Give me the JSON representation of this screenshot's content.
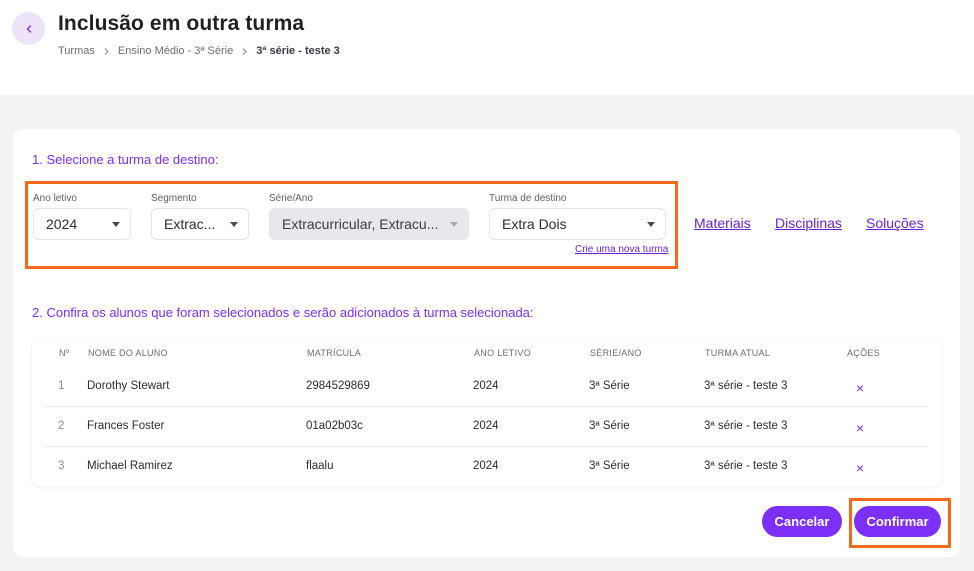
{
  "header": {
    "title": "Inclusão em outra turma",
    "breadcrumb": [
      "Turmas",
      "Ensino Médio - 3ª Série",
      "3ª série - teste 3"
    ]
  },
  "section1": {
    "title": "1. Selecione a turma de destino:",
    "fields": {
      "ano_letivo": {
        "label": "Ano letivo",
        "value": "2024"
      },
      "segmento": {
        "label": "Segmento",
        "value": "Extrac..."
      },
      "serie_ano": {
        "label": "Série/Ano",
        "value": "Extracurricular, Extracu..."
      },
      "turma_destino": {
        "label": "Turma de destino",
        "value": "Extra Dois"
      }
    },
    "new_class_link": "Crie uma nova turma",
    "links": [
      "Materiais",
      "Disciplinas",
      "Soluções"
    ]
  },
  "section2": {
    "title": "2. Confira os alunos que foram selecionados e serão adicionados à turma selecionada:",
    "columns": [
      "Nº",
      "NOME DO ALUNO",
      "MATRÍCULA",
      "ANO LETIVO",
      "SÉRIE/ANO",
      "TURMA ATUAL",
      "AÇÕES"
    ],
    "rows": [
      {
        "n": "1",
        "name": "Dorothy Stewart",
        "matricula": "2984529869",
        "ano": "2024",
        "serie": "3ª Série",
        "turma": "3ª série - teste 3",
        "action": "×"
      },
      {
        "n": "2",
        "name": "Frances Foster",
        "matricula": "01a02b03c",
        "ano": "2024",
        "serie": "3ª Série",
        "turma": "3ª série - teste 3",
        "action": "×"
      },
      {
        "n": "3",
        "name": "Michael Ramirez",
        "matricula": "flaalu",
        "ano": "2024",
        "serie": "3ª Série",
        "turma": "3ª série - teste 3",
        "action": "×"
      }
    ]
  },
  "actions": {
    "cancel": "Cancelar",
    "confirm": "Confirmar"
  },
  "icons": {
    "back": "chevron-left-icon",
    "breadcrumb_separator": "chevron-right-icon",
    "select": "caret-down-icon",
    "remove": "close-icon"
  },
  "colors": {
    "accent": "#7b2ff7",
    "highlight": "#f26b1d",
    "background": "#f3f3f5"
  }
}
